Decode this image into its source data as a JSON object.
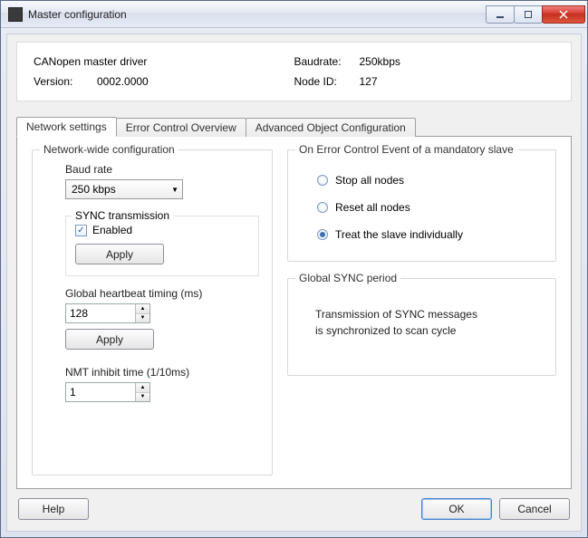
{
  "window": {
    "title": "Master configuration"
  },
  "info": {
    "driver_label": "CANopen master driver",
    "version_label": "Version:",
    "version_value": "0002.0000",
    "baudrate_label": "Baudrate:",
    "baudrate_value": "250kbps",
    "nodeid_label": "Node ID:",
    "nodeid_value": "127"
  },
  "tabs": {
    "network": "Network settings",
    "error": "Error Control Overview",
    "advanced": "Advanced Object Configuration"
  },
  "network": {
    "group_label": "Network-wide configuration",
    "baud_label": "Baud rate",
    "baud_value": "250 kbps",
    "sync_group": "SYNC transmission",
    "sync_enabled_label": "Enabled",
    "sync_enabled_check": "✓",
    "apply1": "Apply",
    "heartbeat_label": "Global heartbeat timing (ms)",
    "heartbeat_value": "128",
    "apply2": "Apply",
    "nmt_label": "NMT inhibit time (1/10ms)",
    "nmt_value": "1"
  },
  "error_event": {
    "group_label": "On Error Control Event of a mandatory slave",
    "opt_stop": "Stop all nodes",
    "opt_reset": "Reset all nodes",
    "opt_individual": "Treat the slave individually",
    "selected": "individual"
  },
  "sync_period": {
    "group_label": "Global SYNC period",
    "text_line1": "Transmission of SYNC messages",
    "text_line2": "is synchronized to scan cycle"
  },
  "footer": {
    "help": "Help",
    "ok": "OK",
    "cancel": "Cancel"
  }
}
